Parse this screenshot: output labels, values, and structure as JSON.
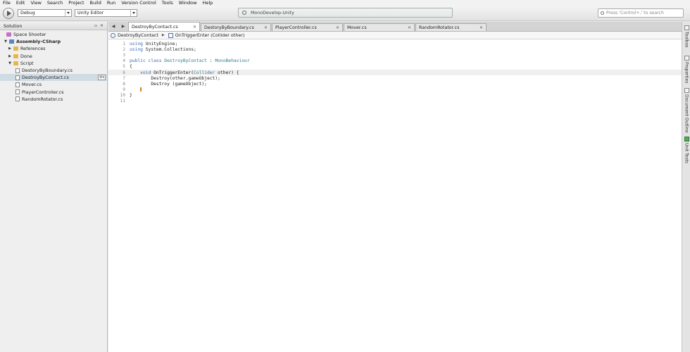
{
  "menu": [
    "File",
    "Edit",
    "View",
    "Search",
    "Project",
    "Build",
    "Run",
    "Version Control",
    "Tools",
    "Window",
    "Help"
  ],
  "toolbar": {
    "configuration": "Debug",
    "target": "Unity Editor",
    "status": "MonoDevelop-Unity",
    "search_placeholder": "Press 'Control+,' to search"
  },
  "solution": {
    "title": "Solution",
    "items": [
      {
        "label": "Space Shooter",
        "icon": "solution-icon"
      },
      {
        "label": "Assembly-CSharp",
        "icon": "project-icon"
      },
      {
        "label": "References",
        "icon": "folder-icon"
      },
      {
        "label": "Done",
        "icon": "folder-icon"
      },
      {
        "label": "Script",
        "icon": "folder-icon"
      },
      {
        "label": "DestoryByBoundary.cs",
        "icon": "file-icon"
      },
      {
        "label": "DestroyByContact.cs",
        "icon": "file-icon",
        "selected": true
      },
      {
        "label": "Mover.cs",
        "icon": "file-icon"
      },
      {
        "label": "PlayerController.cs",
        "icon": "file-icon"
      },
      {
        "label": "RandomRotator.cs",
        "icon": "file-icon"
      }
    ]
  },
  "tabs": [
    {
      "label": "DestroyByContact.cs",
      "active": true
    },
    {
      "label": "DestoryByBoundary.cs"
    },
    {
      "label": "PlayerController.cs"
    },
    {
      "label": "Mover.cs"
    },
    {
      "label": "RandomRotator.cs"
    }
  ],
  "path_bar": {
    "class_name": "DestroyByContact",
    "member": "OnTriggerEnter (Collider other)"
  },
  "code": {
    "current_line": 6,
    "lines": [
      {
        "n": "1"
      },
      {
        "n": "2"
      },
      {
        "n": "3"
      },
      {
        "n": "4"
      },
      {
        "n": "5"
      },
      {
        "n": "6"
      },
      {
        "n": "7"
      },
      {
        "n": "8"
      },
      {
        "n": "9"
      },
      {
        "n": "10"
      },
      {
        "n": "11"
      }
    ],
    "tokens": {
      "l1_kw": "using",
      "l1_rest": " UnityEngine;",
      "l2_kw": "using",
      "l2_rest": " System.Collections;",
      "l4_kw1": "public",
      "l4_kw2": " class",
      "l4_ty1": " DestroyByContact",
      "l4_rest": " : ",
      "l4_ty2": "MonoBehaviour",
      "l5": "{",
      "l6_indent": "    ",
      "l6_kw": "void",
      "l6_name": " OnTriggerEnter(",
      "l6_ty": "Collider",
      "l6_rest": " other) {",
      "l7": "        Destroy(other.gameObject);",
      "l8": "        Destroy (gameObject);",
      "l9_indent": "    ",
      "l10": "}"
    }
  },
  "right_dock": [
    "Toolbox",
    "Properties",
    "Document Outline",
    "Unit Tests"
  ]
}
